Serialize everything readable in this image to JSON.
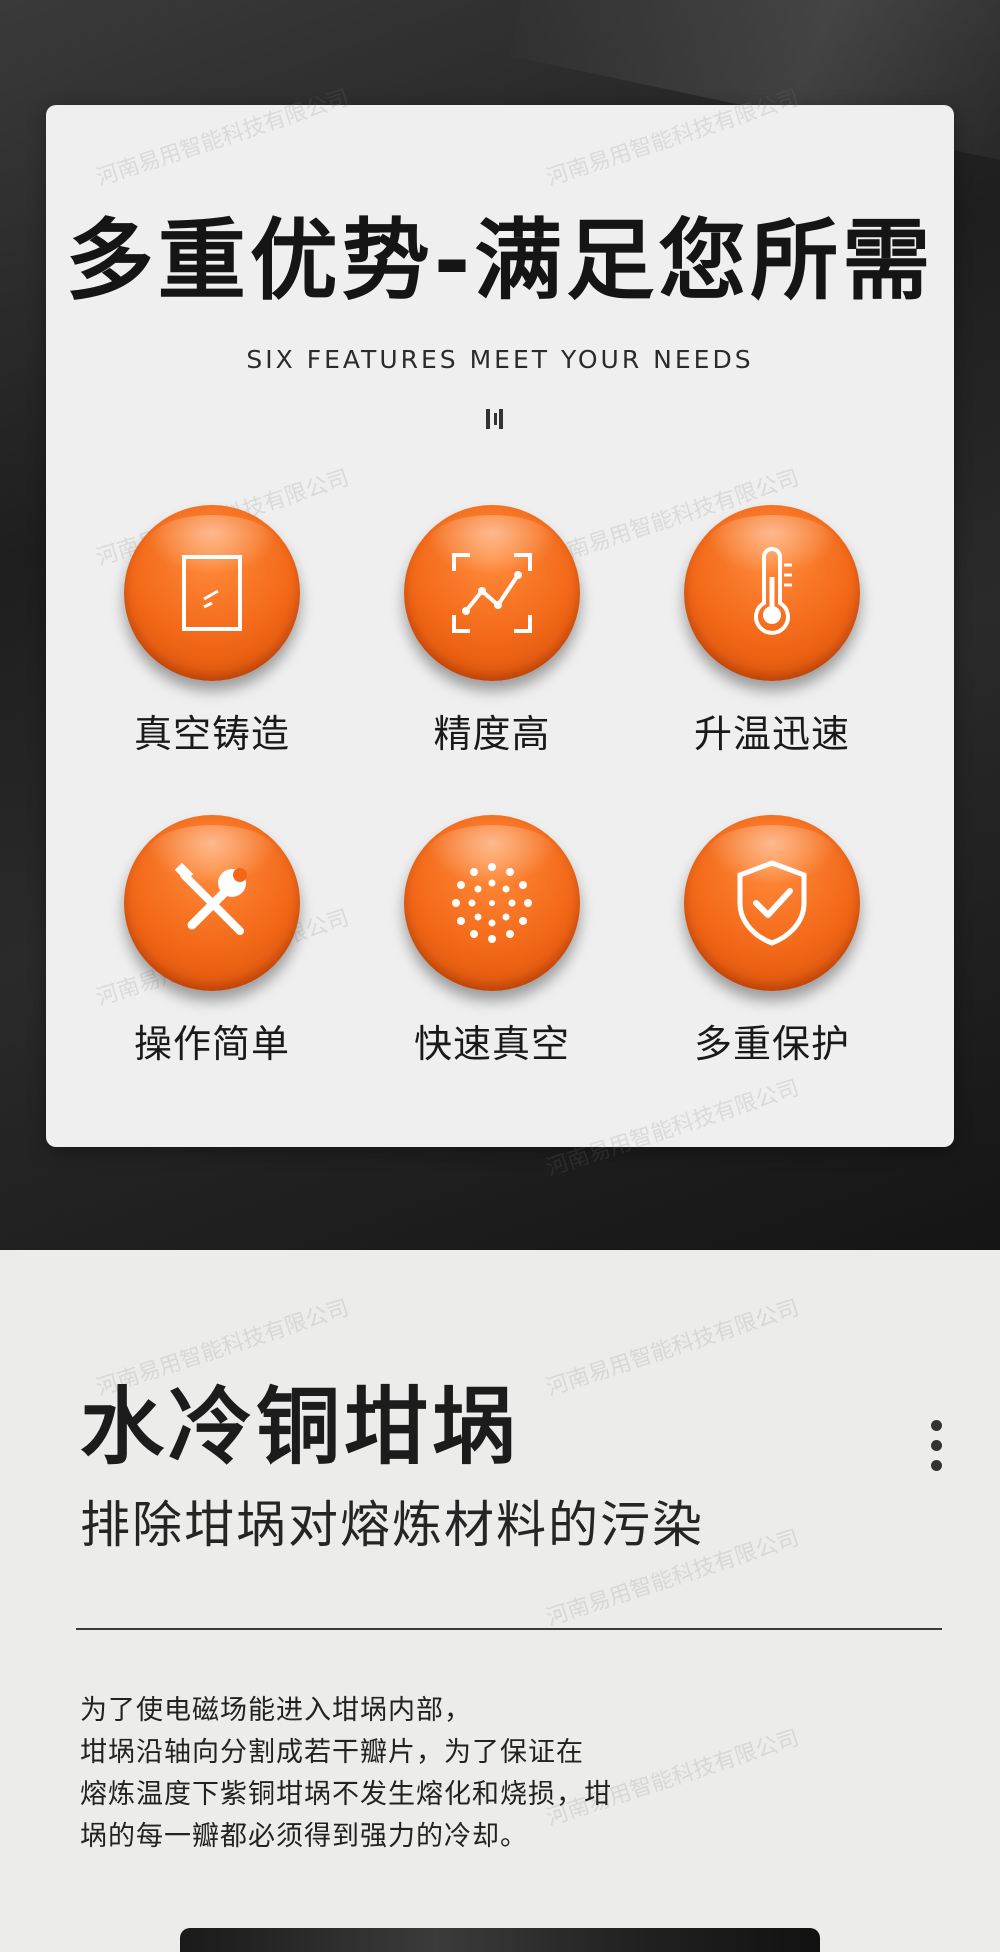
{
  "header": {
    "title": "多重优势-满足您所需",
    "subtitle": "SIX FEATURES MEET YOUR NEEDS"
  },
  "features": [
    {
      "label": "真空铸造",
      "icon": "frame-icon"
    },
    {
      "label": "精度高",
      "icon": "chart-scan-icon"
    },
    {
      "label": "升温迅速",
      "icon": "thermometer-icon"
    },
    {
      "label": "操作简单",
      "icon": "tools-icon"
    },
    {
      "label": "快速真空",
      "icon": "dots-circle-icon"
    },
    {
      "label": "多重保护",
      "icon": "shield-check-icon"
    }
  ],
  "section": {
    "title": "水冷铜坩埚",
    "subtitle": "排除坩埚对熔炼材料的污染",
    "description": [
      "为了使电磁场能进入坩埚内部，",
      "坩埚沿轴向分割成若干瓣片，为了保证在",
      "熔炼温度下紫铜坩埚不发生熔化和烧损，坩",
      "埚的每一瓣都必须得到强力的冷却。"
    ]
  },
  "watermark": "河南易用智能科技有限公司",
  "colors": {
    "accent_orange": "#f26818",
    "dark_bg": "#1e1e1e",
    "card_bg": "#efefef"
  }
}
